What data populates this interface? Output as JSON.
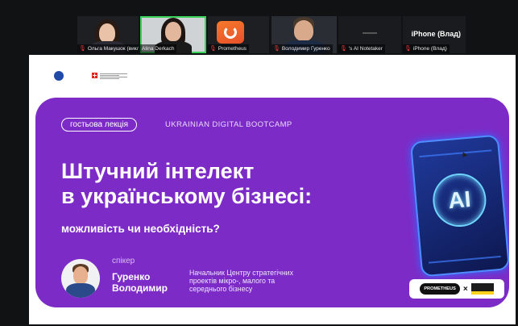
{
  "participants": [
    {
      "name": "Ольга Макушок (викл...",
      "mic": "muted"
    },
    {
      "name": "Alina Derkach",
      "mic": "active"
    },
    {
      "name": "Prometheus",
      "mic": "muted"
    },
    {
      "name": "Володимир Гуренко",
      "mic": "muted"
    },
    {
      "name": "'s AI Notetaker",
      "mic": "muted"
    },
    {
      "name": "iPhone (Влад)",
      "mic": "muted"
    }
  ],
  "overflow_tile": {
    "label": "iPhone (Влад)"
  },
  "slide": {
    "tag": "гостьова лекція",
    "program": "UKRAINIAN DIGITAL BOOTCAMP",
    "title_line1": "Штучний інтелект",
    "title_line2": "в українському бізнесі:",
    "subtitle": "можливість чи необхідність?",
    "speaker_label": "спікер",
    "speaker_first": "Гуренко",
    "speaker_last": "Володимир",
    "speaker_role": "Начальник Центру стратегічних проектів мікро-, малого та середнього бізнесу",
    "chip_text": "AI",
    "partner_prometheus": "PROMETHEUS",
    "partner_cross": "×"
  },
  "colors": {
    "banner": "#7d2bc6",
    "active_speaker": "#3ad35a",
    "muted_mic": "#e23b3b"
  }
}
